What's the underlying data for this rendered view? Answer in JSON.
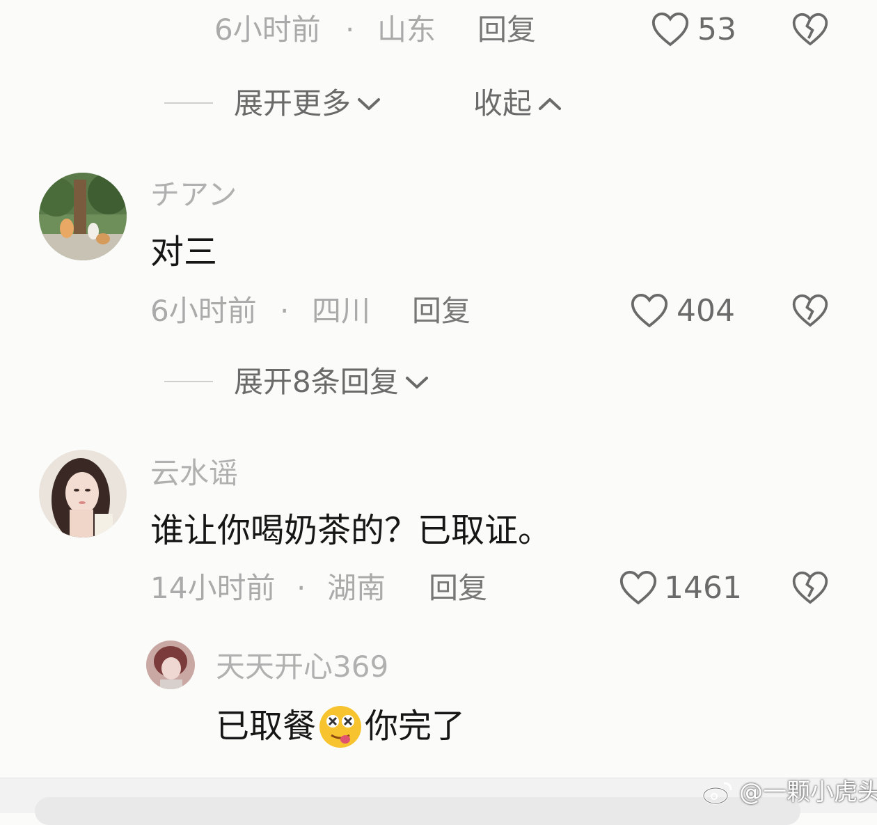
{
  "comments": [
    {
      "time": "6小时前",
      "dot": "·",
      "location": "山东",
      "reply_label": "回复",
      "likes": "53"
    },
    {
      "username": "チアン",
      "text": "对三",
      "time": "6小时前",
      "dot": "·",
      "location": "四川",
      "reply_label": "回复",
      "likes": "404"
    },
    {
      "username": "云水谣",
      "text": "谁让你喝奶茶的？已取证。",
      "time": "14小时前",
      "dot": "·",
      "location": "湖南",
      "reply_label": "回复",
      "likes": "1461"
    }
  ],
  "sub_reply": {
    "username": "天天开心369",
    "text_before": "已取餐",
    "emoji": "😵",
    "text_after": "你完了"
  },
  "expand_more": {
    "label": "展开更多",
    "icon": "chevron-down-icon"
  },
  "collapse": {
    "label": "收起",
    "icon": "chevron-up-icon"
  },
  "expand_replies": {
    "label": "展开8条回复",
    "icon": "chevron-down-icon"
  },
  "watermark": {
    "text": "@一颗小虎头",
    "icon": "weibo-logo-icon"
  },
  "colors": {
    "background": "#fbfbfa",
    "meta_text": "#aaaaaa",
    "content_text": "#161616",
    "icon": "#6a6a6a"
  }
}
